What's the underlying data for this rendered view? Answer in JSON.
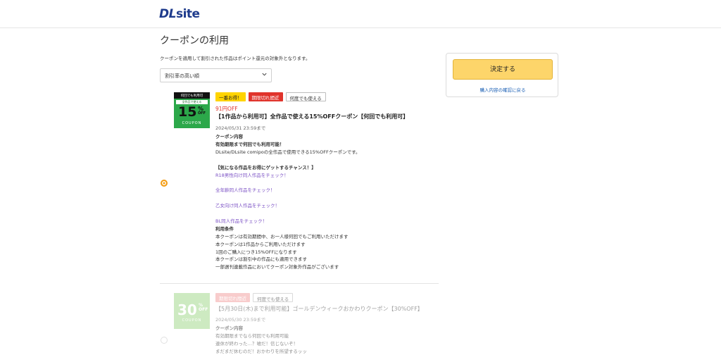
{
  "header": {
    "logo_text_dl": "DL",
    "logo_text_site": "site"
  },
  "page": {
    "title": "クーポンの利用",
    "notice": "クーポンを適用して割引された作品はポイント還元の対象外となります。"
  },
  "sort": {
    "selected": "割引率の高い順"
  },
  "coupons": [
    {
      "selected": true,
      "thumb": {
        "band": "何回でも利用可",
        "sub": "全作品で使える",
        "big": "15",
        "pct": "%",
        "small": "OFF",
        "coupon": "COUPON"
      },
      "badges": [
        "一番お得！",
        "期限切れ間近",
        "何度でも使える"
      ],
      "price": "91円OFF",
      "title": "【1作品から利用可】全作品で使える15%OFFクーポン【何回でも利用可】",
      "date": "2024/05/31 23:59まで",
      "lines": [
        "クーポン内容",
        "有効期限まで何回でも利用可能！",
        "DLsite/DLsite comipoの全作品で使用できる15%OFFクーポンです。",
        "",
        "【気になる作品をお得にゲットするチャンス！】",
        "R18男性向け同人作品をチェック！",
        "",
        "全年齢同人作品をチェック！",
        "",
        "乙女向け同人作品をチェック！",
        "",
        "BL同人作品をチェック！",
        "利用条件",
        "本クーポンは有効期間中、お一人様何回でもご利用いただけます",
        "本クーポンは1作品からご利用いただけます",
        "1回のご購入につき15%OFFになります",
        "本クーポンは割引中の作品にも適用できます",
        "一部週刊連載作品においてクーポン対象外作品がございます"
      ]
    },
    {
      "selected": false,
      "thumb": {
        "big": "30",
        "pct": "%",
        "small": "OFF",
        "coupon": "COUPON"
      },
      "badges": [
        "期限切れ間近",
        "何度でも使える"
      ],
      "title": "【5月30日(木)まで利用可能】ゴールデンウィークおかわりクーポン【30%OFF】",
      "date": "2024/05/30 23:59まで",
      "lines": [
        "クーポン内容",
        "有効期限までなら何回でも利用可能",
        "連休が終わった…？嘘だ！信じないぞ！",
        "まだまだ休むのだ！おかわりを所望するッッ"
      ]
    }
  ],
  "panel": {
    "confirm_label": "決定する",
    "back_label": "購入内容の確認に戻る"
  },
  "colors": {
    "accent": "#f39c12",
    "logo": "#1e3b8c",
    "link": "#7a4fc4",
    "confirm": "#fdd56a",
    "red_badge": "#e0342c"
  }
}
